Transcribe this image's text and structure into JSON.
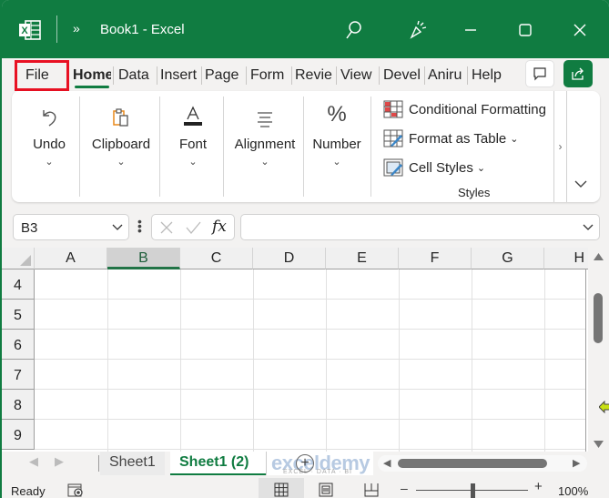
{
  "titlebar": {
    "app_icon": "excel-logo-icon",
    "overflow": "»",
    "title": "Book1  -  Excel",
    "buttons": [
      "search-icon",
      "copilot-icon",
      "minimize-icon",
      "maximize-icon",
      "close-icon"
    ]
  },
  "tabs": [
    {
      "label": "File",
      "highlighted": true
    },
    {
      "label": "Home",
      "active": true
    },
    {
      "label": "Data"
    },
    {
      "label": "Insert"
    },
    {
      "label": "Page"
    },
    {
      "label": "Form"
    },
    {
      "label": "Revie"
    },
    {
      "label": "View"
    },
    {
      "label": "Devel"
    },
    {
      "label": "Aniru"
    },
    {
      "label": "Help"
    }
  ],
  "tab_actions": [
    "comments-icon",
    "share-icon"
  ],
  "ribbon": {
    "groups": [
      {
        "label": "Undo",
        "icon": "undo-icon"
      },
      {
        "label": "Clipboard",
        "icon": "clipboard-icon"
      },
      {
        "label": "Font",
        "icon": "font-color-icon"
      },
      {
        "label": "Alignment",
        "icon": "align-icon"
      },
      {
        "label": "Number",
        "icon": "percent-icon"
      }
    ],
    "styles": {
      "items": [
        "Conditional Formatting",
        "Format as Table",
        "Cell Styles"
      ],
      "label": "Styles"
    },
    "scroll_right": "›",
    "expand": "⌄"
  },
  "formula_bar": {
    "name_box": "B3",
    "fx": "fx",
    "value": ""
  },
  "grid": {
    "columns": [
      "A",
      "B",
      "C",
      "D",
      "E",
      "F",
      "G",
      "H"
    ],
    "selected_column": "B",
    "rows": [
      "4",
      "5",
      "6",
      "7",
      "8",
      "9"
    ]
  },
  "sheets": {
    "tabs": [
      "Sheet1",
      "Sheet1 (2)"
    ],
    "active": "Sheet1 (2)",
    "add": "+"
  },
  "status": {
    "mode": "Ready",
    "zoom": "100%",
    "zoom_level": 1.0
  },
  "watermark": {
    "brand": "exceldemy",
    "tagline": "EXCEL · DATA · BI"
  },
  "colors": {
    "brand": "#107c41",
    "highlight": "#e81123"
  }
}
